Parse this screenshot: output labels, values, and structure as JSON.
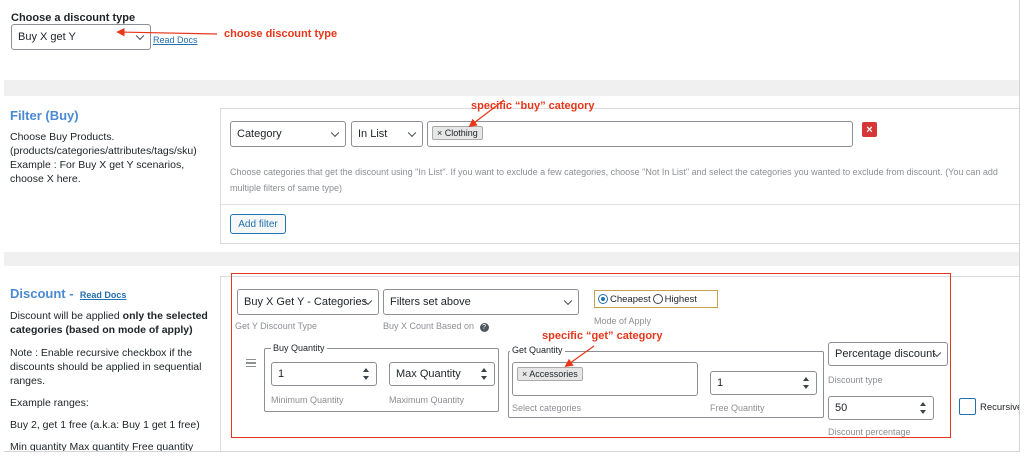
{
  "discount_type_section": {
    "label": "Choose a discount type",
    "selected": "Buy X get Y",
    "docs_link": "Read Docs",
    "annotation": "choose discount type"
  },
  "filter_section": {
    "title": "Filter (Buy)",
    "description": "Choose Buy Products. (products/categories/attributes/tags/sku) Example : For Buy X get Y scenarios, choose X here.",
    "annotation": "specific “buy” category",
    "filter_type": "Category",
    "operator": "In List",
    "chips": [
      "Clothing"
    ],
    "remove_icon": "close-icon",
    "help_text": "Choose categories that get the discount using \"In List\". If you want to exclude a few categories, choose \"Not In List\" and select the categories you wanted to exclude from discount. (You can add multiple filters of same type)",
    "add_filter_label": "Add filter"
  },
  "discount_section": {
    "title": "Discount -",
    "docs_link": "Read Docs",
    "desc_prefix": "Discount will be applied ",
    "desc_bold": "only the selected categories (based on mode of apply)",
    "note": "Note : Enable recursive checkbox if the discounts should be applied in sequential ranges.",
    "example_heading": "Example ranges:",
    "example_1": "Buy 2, get 1 free (a.k.a: Buy 1 get 1 free)",
    "example_2": "Min quantity Max quantity Free quantity",
    "get_y_type": "Buy X Get Y - Categories",
    "get_y_type_caption": "Get Y Discount Type",
    "count_based": "Filters set above",
    "count_based_caption": "Buy X Count Based on",
    "mode_options": [
      "Cheapest",
      "Highest"
    ],
    "mode_selected": "Cheapest",
    "mode_caption": "Mode of Apply",
    "annotation": "specific “get” category",
    "buy_quantity_legend": "Buy Quantity",
    "min_qty_value": "1",
    "min_qty_caption": "Minimum Quantity",
    "max_qty_placeholder": "Max Quantity",
    "max_qty_caption": "Maximum Quantity",
    "get_quantity_legend": "Get Quantity",
    "get_chips": [
      "Accessories"
    ],
    "select_categories_caption": "Select categories",
    "free_qty_value": "1",
    "free_qty_caption": "Free Quantity",
    "discount_type_value": "Percentage discount",
    "discount_type_caption": "Discount type",
    "discount_pct_value": "50",
    "discount_pct_caption": "Discount percentage",
    "recursive_label": "Recursive?"
  },
  "colors": {
    "annotation": "#e8361a",
    "section_title": "#4a8ad2",
    "link": "#2271b1",
    "remove": "#d63638",
    "mode_border": "#c8a24a"
  }
}
